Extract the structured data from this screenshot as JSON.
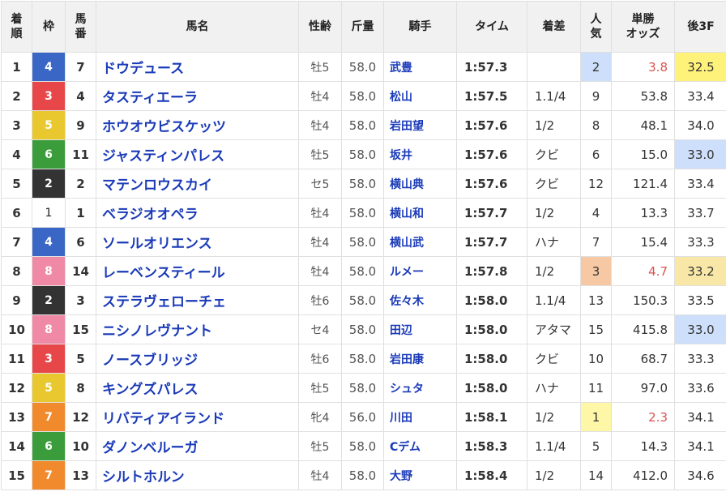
{
  "headers": {
    "rank": [
      "着",
      "順"
    ],
    "waku": "枠",
    "umaban": [
      "馬",
      "番"
    ],
    "name": "馬名",
    "sex_age": "性齢",
    "weight": "斤量",
    "jockey": "騎手",
    "time": "タイム",
    "margin": "着差",
    "popularity": [
      "人",
      "気"
    ],
    "odds": [
      "単勝",
      "オッズ"
    ],
    "last3f": "後3F"
  },
  "colors": {
    "waku": {
      "1": "#ffffff",
      "2": "#333333",
      "3": "#e8474a",
      "4": "#3a66c5",
      "5": "#e8c82e",
      "6": "#3b9c3b",
      "7": "#f08a2c",
      "8": "#f089a5"
    },
    "pop1_bg": "#fff7a8",
    "pop2_bg": "#cddffb",
    "pop3_bg": "#f6c9a4",
    "last3f_best_bg": "#fff27a",
    "last3f_good_bg": "#cddffb",
    "last3f_third_bg": "#f9e7a8",
    "odds_hot": "#d9534f",
    "name_color": "#1a3ab8"
  },
  "rows": [
    {
      "rank": "1",
      "waku": "4",
      "umaban": "7",
      "name": "ドウデュース",
      "sex_age": "牡5",
      "weight": "58.0",
      "jockey": "武豊",
      "time": "1:57.3",
      "margin": "",
      "pop": "2",
      "odds": "3.8",
      "last3f": "32.5",
      "pop_hl": "pop2_bg",
      "odds_hot": true,
      "last3f_hl": "last3f_best_bg"
    },
    {
      "rank": "2",
      "waku": "3",
      "umaban": "4",
      "name": "タスティエーラ",
      "sex_age": "牡4",
      "weight": "58.0",
      "jockey": "松山",
      "time": "1:57.5",
      "margin": "1.1/4",
      "pop": "9",
      "odds": "53.8",
      "last3f": "33.4"
    },
    {
      "rank": "3",
      "waku": "5",
      "umaban": "9",
      "name": "ホウオウビスケッツ",
      "sex_age": "牡4",
      "weight": "58.0",
      "jockey": "岩田望",
      "time": "1:57.6",
      "margin": "1/2",
      "pop": "8",
      "odds": "48.1",
      "last3f": "34.0"
    },
    {
      "rank": "4",
      "waku": "6",
      "umaban": "11",
      "name": "ジャスティンパレス",
      "sex_age": "牡5",
      "weight": "58.0",
      "jockey": "坂井",
      "time": "1:57.6",
      "margin": "クビ",
      "pop": "6",
      "odds": "15.0",
      "last3f": "33.0",
      "last3f_hl": "last3f_good_bg"
    },
    {
      "rank": "5",
      "waku": "2",
      "umaban": "2",
      "name": "マテンロウスカイ",
      "sex_age": "セ5",
      "weight": "58.0",
      "jockey": "横山典",
      "time": "1:57.6",
      "margin": "クビ",
      "pop": "12",
      "odds": "121.4",
      "last3f": "33.4"
    },
    {
      "rank": "6",
      "waku": "1",
      "umaban": "1",
      "name": "ベラジオオペラ",
      "sex_age": "牡4",
      "weight": "58.0",
      "jockey": "横山和",
      "time": "1:57.7",
      "margin": "1/2",
      "pop": "4",
      "odds": "13.3",
      "last3f": "33.7"
    },
    {
      "rank": "7",
      "waku": "4",
      "umaban": "6",
      "name": "ソールオリエンス",
      "sex_age": "牡4",
      "weight": "58.0",
      "jockey": "横山武",
      "time": "1:57.7",
      "margin": "ハナ",
      "pop": "7",
      "odds": "15.4",
      "last3f": "33.3"
    },
    {
      "rank": "8",
      "waku": "8",
      "umaban": "14",
      "name": "レーベンスティール",
      "sex_age": "牡4",
      "weight": "58.0",
      "jockey": "ルメー",
      "time": "1:57.8",
      "margin": "1/2",
      "pop": "3",
      "odds": "4.7",
      "last3f": "33.2",
      "pop_hl": "pop3_bg",
      "odds_hot": true,
      "last3f_hl": "last3f_third_bg"
    },
    {
      "rank": "9",
      "waku": "2",
      "umaban": "3",
      "name": "ステラヴェローチェ",
      "sex_age": "牡6",
      "weight": "58.0",
      "jockey": "佐々木",
      "time": "1:58.0",
      "margin": "1.1/4",
      "pop": "13",
      "odds": "150.3",
      "last3f": "33.5"
    },
    {
      "rank": "10",
      "waku": "8",
      "umaban": "15",
      "name": "ニシノレヴナント",
      "sex_age": "セ4",
      "weight": "58.0",
      "jockey": "田辺",
      "time": "1:58.0",
      "margin": "アタマ",
      "pop": "15",
      "odds": "415.8",
      "last3f": "33.0",
      "last3f_hl": "last3f_good_bg"
    },
    {
      "rank": "11",
      "waku": "3",
      "umaban": "5",
      "name": "ノースブリッジ",
      "sex_age": "牡6",
      "weight": "58.0",
      "jockey": "岩田康",
      "time": "1:58.0",
      "margin": "クビ",
      "pop": "10",
      "odds": "68.7",
      "last3f": "33.3"
    },
    {
      "rank": "12",
      "waku": "5",
      "umaban": "8",
      "name": "キングズパレス",
      "sex_age": "牡5",
      "weight": "58.0",
      "jockey": "シュタ",
      "time": "1:58.0",
      "margin": "ハナ",
      "pop": "11",
      "odds": "97.0",
      "last3f": "33.6"
    },
    {
      "rank": "13",
      "waku": "7",
      "umaban": "12",
      "name": "リバティアイランド",
      "sex_age": "牝4",
      "weight": "56.0",
      "jockey": "川田",
      "time": "1:58.1",
      "margin": "1/2",
      "pop": "1",
      "odds": "2.3",
      "last3f": "34.1",
      "pop_hl": "pop1_bg",
      "odds_hot": true
    },
    {
      "rank": "14",
      "waku": "6",
      "umaban": "10",
      "name": "ダノンベルーガ",
      "sex_age": "牡5",
      "weight": "58.0",
      "jockey": "Cデム",
      "time": "1:58.3",
      "margin": "1.1/4",
      "pop": "5",
      "odds": "14.3",
      "last3f": "34.1"
    },
    {
      "rank": "15",
      "waku": "7",
      "umaban": "13",
      "name": "シルトホルン",
      "sex_age": "牡4",
      "weight": "58.0",
      "jockey": "大野",
      "time": "1:58.4",
      "margin": "1/2",
      "pop": "14",
      "odds": "412.0",
      "last3f": "34.6"
    }
  ]
}
